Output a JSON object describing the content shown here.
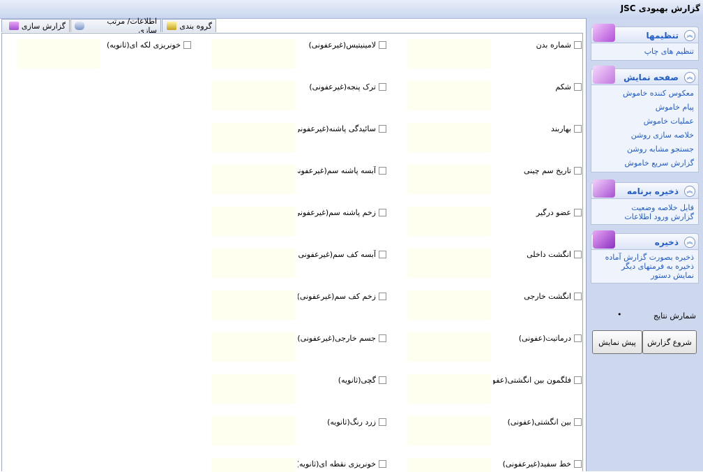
{
  "window": {
    "title": "گزارش بهبودی JSC"
  },
  "tabs": [
    {
      "label": "گزارش سازی",
      "active": true
    },
    {
      "label": "اطلاعات/ مرتب سازی",
      "active": false
    },
    {
      "label": "گروه بندی",
      "active": false
    }
  ],
  "fields": {
    "col1": [
      "شماره بدن",
      "شکم",
      "بهاربند",
      "تاریخ سم چینی",
      "عضو درگیر",
      "انگشت داخلی",
      "انگشت خارجی",
      "درماتیت(عفونی)",
      "فلگمون بین انگشتی(عفونی)",
      "بین انگشتی(عفونی)",
      "خط سفید(غیرعفونی)"
    ],
    "col2": [
      "لامینیتیس(غیرعفونی)",
      "ترک پنجه(غیرعفونی)",
      "سائیدگی پاشنه(غیرعفونی)",
      "آبسه پاشنه سم(غیرعفونی)",
      "زخم پاشنه سم(غیرعفونی)",
      "آبسه کف سم(غیرعفونی)",
      "زخم کف سم(غیرعفونی)",
      "جسم خارجی(غیرعفونی)",
      "گچی(ثانویه)",
      "زرد رنگ(ثانویه)",
      "خونریزی نقطه ای(ثانویه)"
    ],
    "col3": [
      "خونریزی لکه ای(ثانویه)"
    ]
  },
  "panel": {
    "settings": {
      "title": "تنظیمها",
      "items": [
        "تنظیم های چاپ"
      ]
    },
    "display": {
      "title": "صفحه نمایش",
      "items": [
        "معکوس کننده خاموش",
        "پیام خاموش",
        "عملیات خاموش",
        "خلاصه سازی روشن",
        "جستجو مشابه روشن",
        "گزارش سریع خاموش"
      ]
    },
    "program": {
      "title": "ذخیره برنامه",
      "items": [
        "فایل خلاصه وضعیت",
        "گزارش ورود اطلاعات"
      ]
    },
    "save": {
      "title": "ذخیره",
      "items": [
        "ذخیره بصورت گزارش آماده",
        "ذخیره به فرمتهای دیگر",
        "نمایش دستور"
      ]
    },
    "results_label": "شمارش نتایج",
    "results_value": "•",
    "start_button": "شروع گزارش",
    "preview_button": "پیش نمایش"
  },
  "colors": {
    "accent": "#215dc6",
    "panel_bg": "#cdd7ee",
    "field_bg": "#fffff0",
    "icon_purple": "#a24fd0"
  },
  "icons": [
    "report-tab-icon",
    "database-tab-icon",
    "group-tab-icon",
    "settings-gear-icon",
    "display-icon",
    "program-save-icon",
    "save-pen-icon",
    "collapse-chevron-icon"
  ]
}
